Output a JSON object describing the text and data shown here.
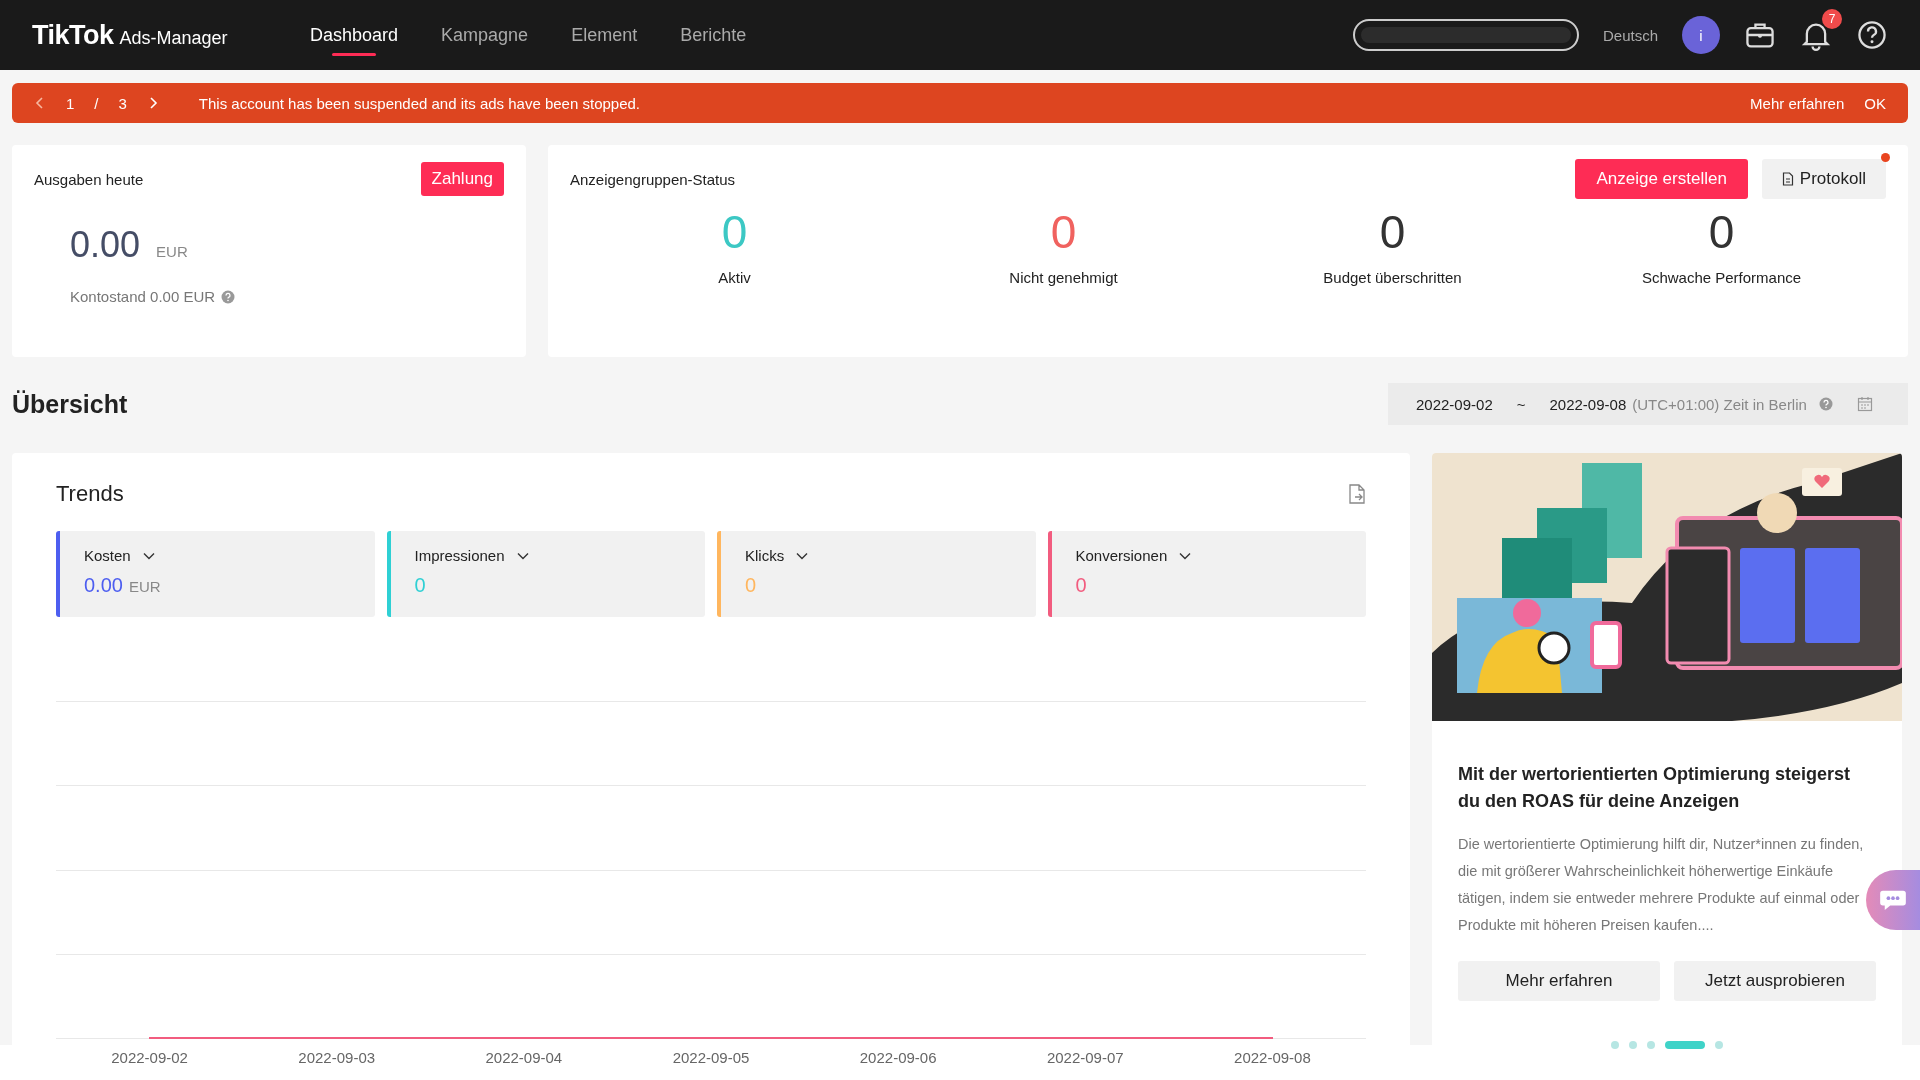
{
  "header": {
    "logo": "TikTok",
    "logo_suffix": "Ads-Manager",
    "nav": [
      {
        "label": "Dashboard",
        "selected": true
      },
      {
        "label": "Kampagne",
        "selected": false
      },
      {
        "label": "Element",
        "selected": false
      },
      {
        "label": "Berichte",
        "selected": false
      }
    ],
    "language": "Deutsch",
    "avatar": "i",
    "notification_count": "7"
  },
  "banner": {
    "page": "1",
    "separator": "/",
    "total": "3",
    "message": "This account has been suspended and its ads have been stopped.",
    "link": "Mehr erfahren",
    "ok": "OK"
  },
  "spend": {
    "title": "Ausgaben heute",
    "button": "Zahlung",
    "amount": "0.00",
    "currency": "EUR",
    "balance": "Kontostand 0.00 EUR"
  },
  "adgroup_status": {
    "title": "Anzeigengruppen-Status",
    "create_button": "Anzeige erstellen",
    "log_button": "Protokoll",
    "log_has_dot": true,
    "items": [
      {
        "count": "0",
        "label": "Aktiv",
        "color": "#3cc8c4"
      },
      {
        "count": "0",
        "label": "Nicht genehmigt",
        "color": "#f0625f"
      },
      {
        "count": "0",
        "label": "Budget überschritten",
        "color": "#333333"
      },
      {
        "count": "0",
        "label": "Schwache Performance",
        "color": "#333333"
      }
    ]
  },
  "overview": {
    "title": "Übersicht",
    "date_from": "2022-09-02",
    "tilde": "~",
    "date_to": "2022-09-08",
    "timezone": "(UTC+01:00) Zeit in Berlin"
  },
  "trends": {
    "title": "Trends",
    "metrics": [
      {
        "label": "Kosten",
        "value": "0.00",
        "unit": "EUR",
        "color": "#4d5ef0"
      },
      {
        "label": "Impressionen",
        "value": "0",
        "color": "#2fd0d4"
      },
      {
        "label": "Klicks",
        "value": "0",
        "color": "#ffb65e"
      },
      {
        "label": "Konversionen",
        "value": "0",
        "color": "#f25c7f"
      }
    ],
    "x_labels": [
      "2022-09-02",
      "2022-09-03",
      "2022-09-04",
      "2022-09-05",
      "2022-09-06",
      "2022-09-07",
      "2022-09-08"
    ]
  },
  "promo": {
    "title": "Mit der wertorientierten Optimierung steigerst du den ROAS für deine Anzeigen",
    "body": "Die wertorientierte Optimierung hilft dir, Nutzer*innen zu finden, die mit größerer Wahrscheinlichkeit höherwertige Einkäufe tätigen, indem sie entweder mehrere Produkte auf einmal oder Produkte mit höheren Preisen kaufen....",
    "buttons": [
      "Mehr erfahren",
      "Jetzt ausprobieren"
    ],
    "dots": [
      {
        "selected": false
      },
      {
        "selected": false
      },
      {
        "selected": false
      },
      {
        "selected": true
      },
      {
        "selected": false
      }
    ]
  }
}
